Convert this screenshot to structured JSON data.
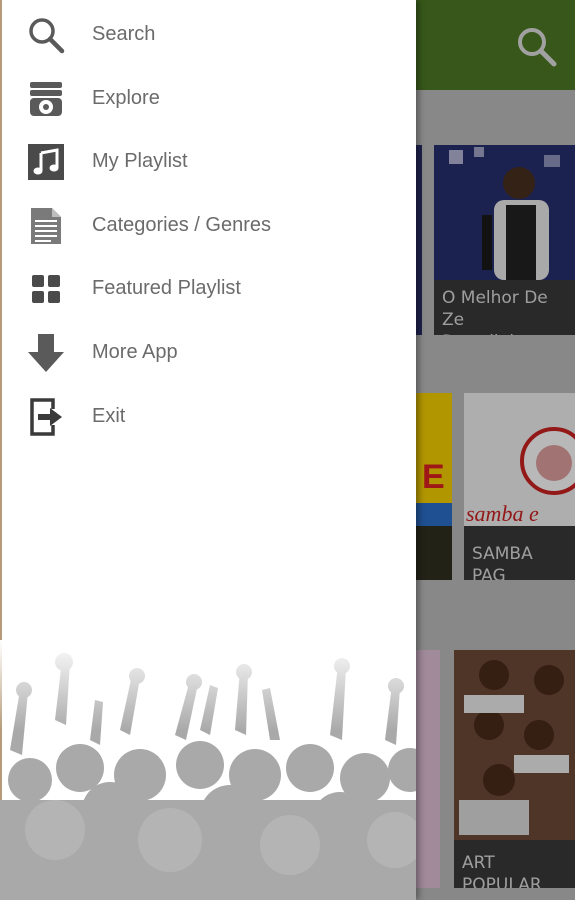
{
  "drawer": {
    "items": [
      {
        "label": "Search",
        "icon": "search-icon"
      },
      {
        "label": "Explore",
        "icon": "explore-icon"
      },
      {
        "label": "My Playlist",
        "icon": "music-note-icon"
      },
      {
        "label": "Categories / Genres",
        "icon": "document-list-icon"
      },
      {
        "label": "Featured Playlist",
        "icon": "grid-icon"
      },
      {
        "label": "More App",
        "icon": "download-arrow-icon"
      },
      {
        "label": "Exit",
        "icon": "exit-icon"
      }
    ],
    "background_image": "crowd-silhouette"
  },
  "app": {
    "toolbar_color": "#4d7a25",
    "cards": [
      {
        "caption": "O Melhor De Ze\nPagodinho"
      },
      {
        "caption": "SAMBA PAG"
      },
      {
        "caption": "ART POPULAR"
      }
    ]
  },
  "colors": {
    "drawer_text": "#6b6b6b",
    "icon": "#5a5a5a"
  }
}
